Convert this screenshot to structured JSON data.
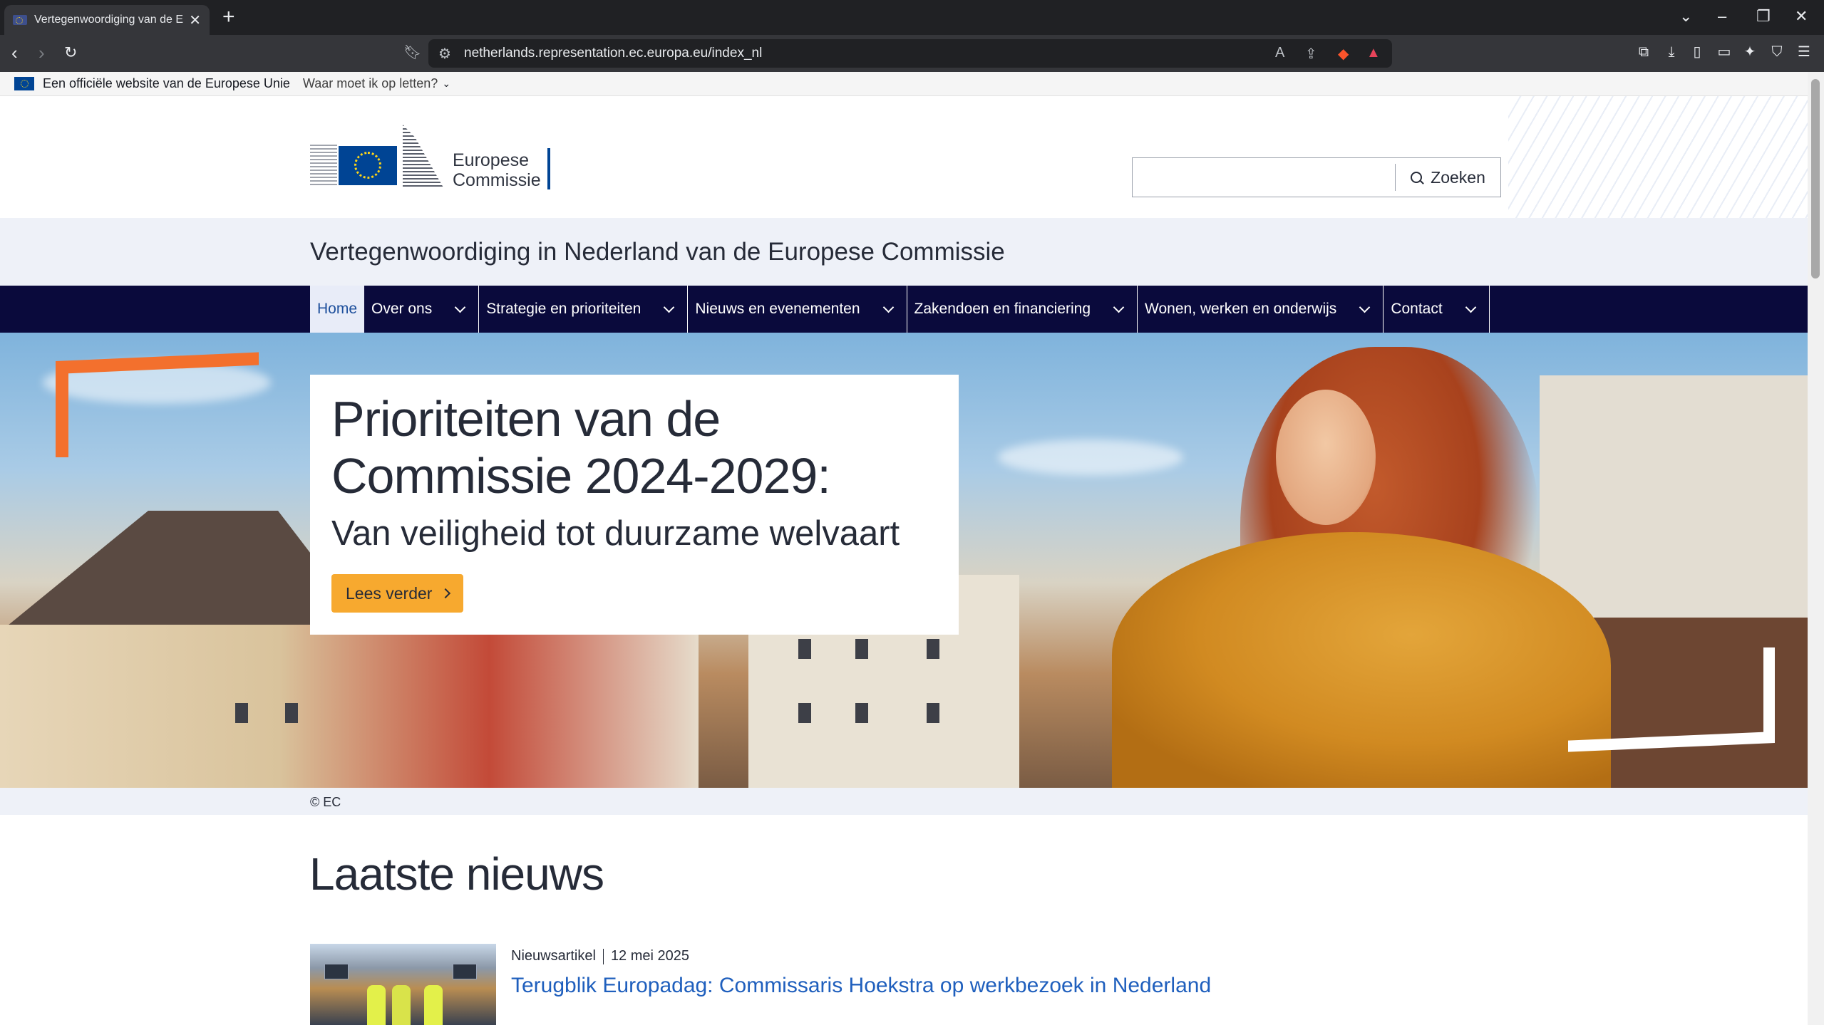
{
  "browser": {
    "tab_title": "Vertegenwoordiging van de Eu",
    "url": "netherlands.representation.ec.europa.eu/index_nl",
    "new_tab": "+",
    "tab_close": "✕"
  },
  "eu_banner": {
    "text": "Een officiële website van de Europese Unie",
    "link": "Waar moet ik op letten?"
  },
  "header": {
    "logo_line1": "Europese",
    "logo_line2": "Commissie",
    "search_placeholder": "",
    "search_button": "Zoeken",
    "site_name": "Vertegenwoordiging in Nederland van de Europese Commissie"
  },
  "nav": {
    "items": [
      {
        "label": "Home"
      },
      {
        "label": "Over ons"
      },
      {
        "label": "Strategie en prioriteiten"
      },
      {
        "label": "Nieuws en evenementen"
      },
      {
        "label": "Zakendoen en financiering"
      },
      {
        "label": "Wonen, werken en onderwijs"
      },
      {
        "label": "Contact"
      }
    ]
  },
  "hero": {
    "title_line1": "Prioriteiten van de",
    "title_line2": "Commissie 2024-2029:",
    "subtitle": "Van veiligheid tot duurzame welvaart",
    "button": "Lees verder",
    "credit": "© EC"
  },
  "news": {
    "heading": "Laatste nieuws",
    "items": [
      {
        "type": "Nieuwsartikel",
        "date": "12 mei 2025",
        "title": "Terugblik Europadag: Commissaris Hoekstra op werkbezoek in Nederland"
      }
    ]
  },
  "colors": {
    "nav_bg": "#0a0a3c",
    "accent_orange": "#f3702d",
    "button_yellow": "#f7a92f",
    "link_blue": "#1f5fbd",
    "eu_blue": "#004494"
  }
}
